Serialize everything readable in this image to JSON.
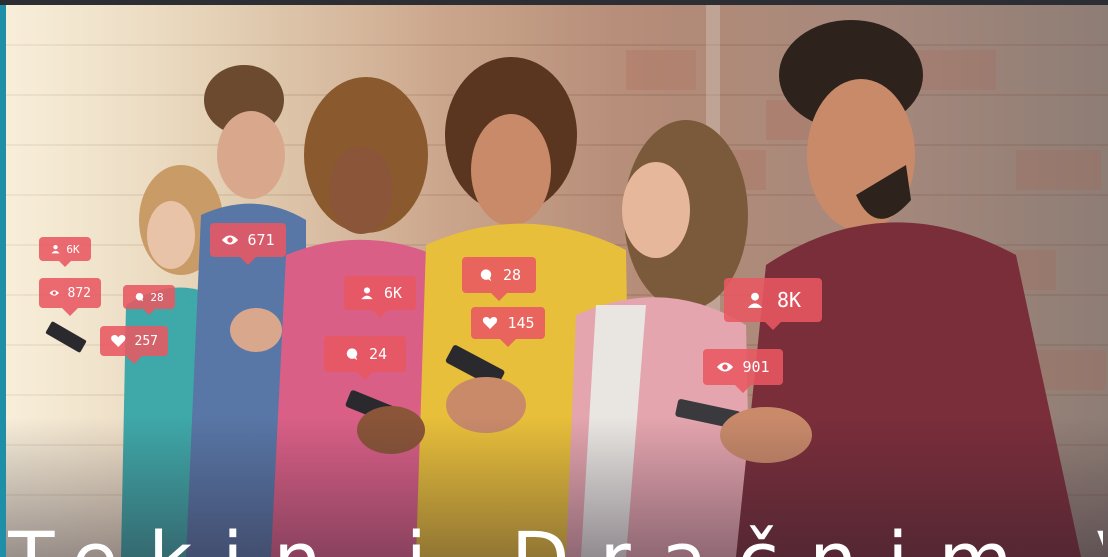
{
  "notifications": [
    {
      "icon": "user-icon",
      "value": "6K"
    },
    {
      "icon": "eye-icon",
      "value": "872"
    },
    {
      "icon": "comment-icon",
      "value": "28"
    },
    {
      "icon": "heart-icon",
      "value": "257"
    },
    {
      "icon": "eye-icon",
      "value": "671"
    },
    {
      "icon": "user-icon",
      "value": "6K"
    },
    {
      "icon": "comment-icon",
      "value": "24"
    },
    {
      "icon": "comment-icon",
      "value": "28"
    },
    {
      "icon": "heart-icon",
      "value": "145"
    },
    {
      "icon": "user-icon",
      "value": "8K"
    },
    {
      "icon": "eye-icon",
      "value": "901"
    }
  ],
  "headline": "Tekin i Dračnim V",
  "colors": {
    "notification_bg": "#e85862",
    "frame": "#2c2e33",
    "accent": "#1f8fa8"
  }
}
